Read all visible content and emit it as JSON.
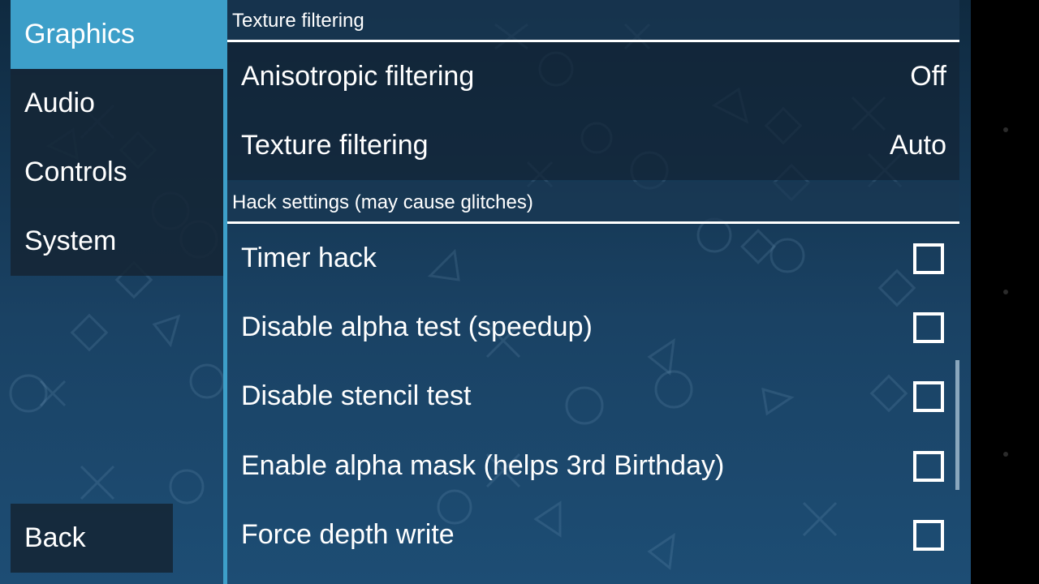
{
  "sidebar": {
    "tabs": [
      {
        "label": "Graphics",
        "active": true
      },
      {
        "label": "Audio",
        "active": false
      },
      {
        "label": "Controls",
        "active": false
      },
      {
        "label": "System",
        "active": false
      }
    ],
    "back_label": "Back"
  },
  "sections": {
    "texture_filtering": {
      "header": "Texture filtering",
      "rows": [
        {
          "label": "Anisotropic filtering",
          "value": "Off"
        },
        {
          "label": "Texture filtering",
          "value": "Auto"
        }
      ]
    },
    "hack_settings": {
      "header": "Hack settings (may cause glitches)",
      "rows": [
        {
          "label": "Timer hack",
          "checked": false
        },
        {
          "label": "Disable alpha test (speedup)",
          "checked": false
        },
        {
          "label": "Disable stencil test",
          "checked": false
        },
        {
          "label": "Enable alpha mask (helps 3rd Birthday)",
          "checked": false
        },
        {
          "label": "Force depth write",
          "checked": false
        }
      ]
    }
  },
  "colors": {
    "accent": "#3d9fc9",
    "background_top": "#0f2a40",
    "background_bottom": "#1d4d74",
    "tab_background": "#142636"
  },
  "icons": [
    "triangle-icon",
    "circle-icon",
    "cross-icon",
    "square-icon",
    "checkbox-icon"
  ]
}
